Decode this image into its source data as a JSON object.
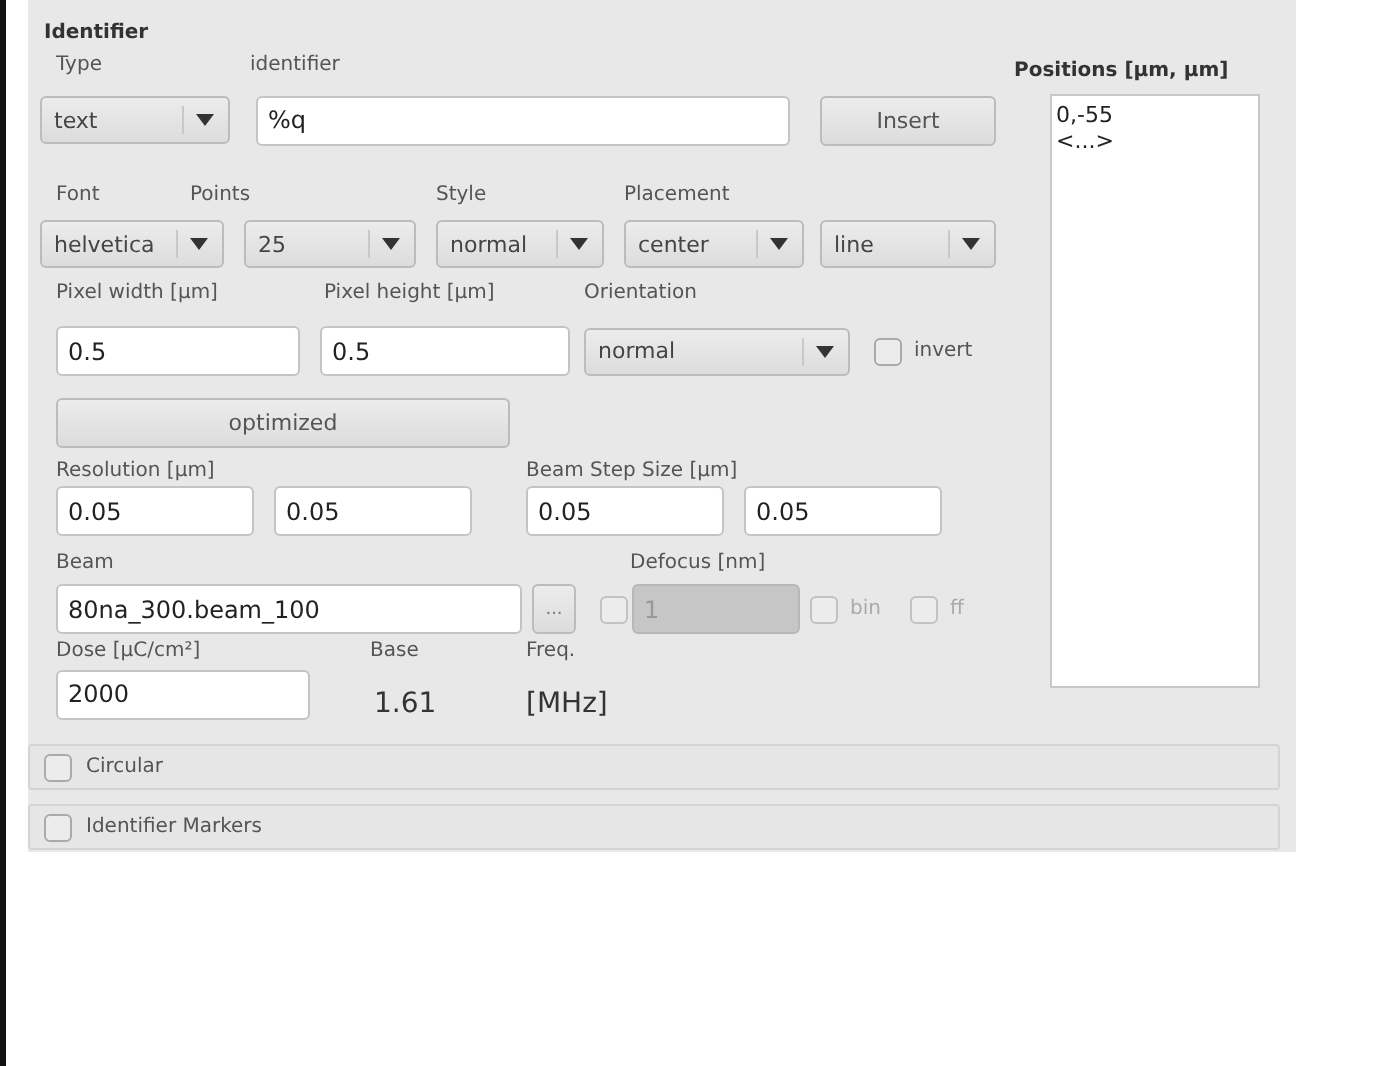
{
  "group": {
    "title": "Identifier"
  },
  "type": {
    "label": "Type",
    "value": "text"
  },
  "identifier": {
    "label": "identifier",
    "value": "%q"
  },
  "insert_button": {
    "label": "Insert"
  },
  "font": {
    "label": "Font",
    "value": "helvetica"
  },
  "points": {
    "label": "Points",
    "value": "25"
  },
  "style": {
    "label": "Style",
    "value": "normal"
  },
  "placement": {
    "label": "Placement",
    "value": "center"
  },
  "placement_mode": {
    "value": "line"
  },
  "pixel_width": {
    "label": "Pixel width [µm]",
    "value": "0.5"
  },
  "pixel_height": {
    "label": "Pixel height [µm]",
    "value": "0.5"
  },
  "orientation": {
    "label": "Orientation",
    "value": "normal"
  },
  "invert": {
    "label": "invert",
    "checked": false,
    "disabled": false
  },
  "optimized_button": {
    "label": "optimized"
  },
  "resolution": {
    "label": "Resolution [µm]",
    "values": [
      "0.05",
      "0.05"
    ]
  },
  "beam_step_size": {
    "label": "Beam Step Size [µm]",
    "values": [
      "0.05",
      "0.05"
    ]
  },
  "beam": {
    "label": "Beam",
    "value": "80na_300.beam_100",
    "browse_button": "..."
  },
  "defocus": {
    "label": "Defocus [nm]",
    "checked": false,
    "value": "1",
    "disabled": true
  },
  "bin": {
    "label": "bin",
    "checked": false,
    "disabled": true
  },
  "ff": {
    "label": "ff",
    "checked": false,
    "disabled": true
  },
  "dose": {
    "label": "Dose [µC/cm²]",
    "value": "2000"
  },
  "base": {
    "label": "Base",
    "value": "1.61"
  },
  "freq": {
    "label": "Freq.",
    "unit": "[MHz]"
  },
  "positions": {
    "label": "Positions [µm, µm]",
    "items": [
      "0,-55",
      "<...>"
    ]
  },
  "sections": [
    {
      "label": "Circular",
      "checked": false
    },
    {
      "label": "Identifier Markers",
      "checked": false
    }
  ]
}
